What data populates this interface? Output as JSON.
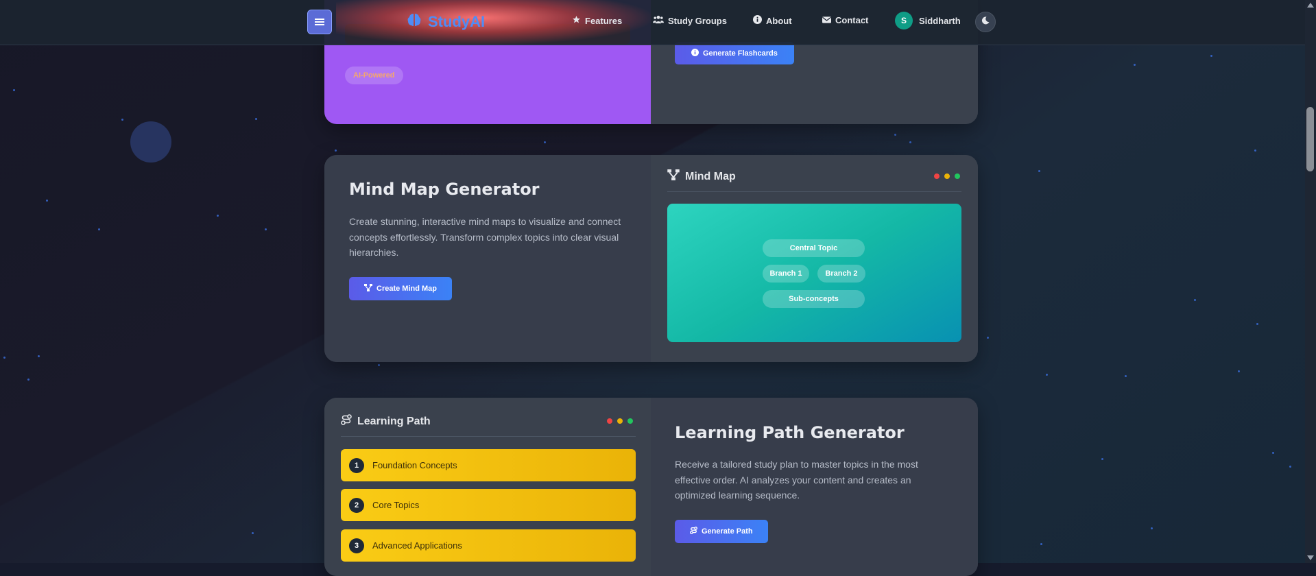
{
  "nav": {
    "brand": "StudyAI",
    "links": [
      "Features",
      "Study Groups",
      "About",
      "Contact"
    ],
    "user": {
      "name": "Siddharth",
      "initial": "S"
    }
  },
  "card1": {
    "badge": "AI-Powered",
    "button": "Generate Flashcards"
  },
  "mindmap": {
    "title": "Mind Map Generator",
    "description": "Create stunning, interactive mind maps to visualize and connect concepts effortlessly. Transform complex topics into clear visual hierarchies.",
    "button": "Create Mind Map",
    "panel_title": "Mind Map",
    "nodes": {
      "central": "Central Topic",
      "branch1": "Branch 1",
      "branch2": "Branch 2",
      "sub": "Sub-concepts"
    }
  },
  "learning": {
    "panel_title": "Learning Path",
    "steps": [
      {
        "num": "1",
        "label": "Foundation Concepts"
      },
      {
        "num": "2",
        "label": "Core Topics"
      },
      {
        "num": "3",
        "label": "Advanced Applications"
      }
    ],
    "title": "Learning Path Generator",
    "description": "Receive a tailored study plan to master topics in the most effective order. AI analyzes your content and creates an optimized learning sequence.",
    "button": "Generate Path"
  },
  "colors": {
    "accent": "#4f8cf6",
    "purple": "#9f58f3",
    "teal": "#14b8a6",
    "yellow": "#eab308",
    "window_dots": [
      "#ef4444",
      "#eab308",
      "#22c55e"
    ]
  }
}
